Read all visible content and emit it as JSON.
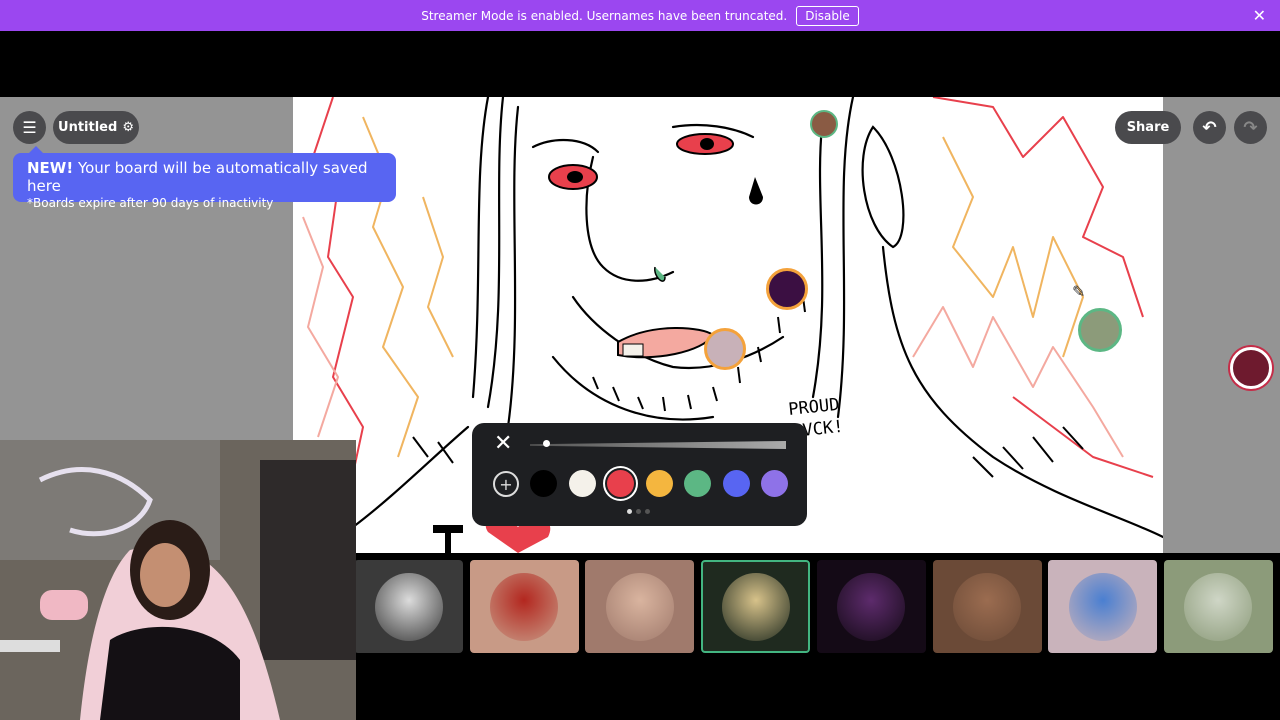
{
  "banner": {
    "message": "Streamer Mode is enabled. Usernames have been truncated.",
    "disable_label": "Disable",
    "close_icon": "close-icon"
  },
  "toolbar": {
    "board_title": "Untitled",
    "share_label": "Share"
  },
  "tip": {
    "headline": "NEW!",
    "message": " Your board will be automatically saved here",
    "subtext": "*Boards expire after 90 days of inactivity"
  },
  "drawing_text": {
    "line1": "PROUD",
    "line2": "CVCK!"
  },
  "palette": {
    "close_icon": "close-icon",
    "add_icon": "plus-icon",
    "brush_size": 0.05,
    "colors": [
      "#000000",
      "#f4f1ea",
      "#e8404c",
      "#f4b63f",
      "#5cb784",
      "#5865f2",
      "#8e72e8"
    ],
    "selected_color": "#e8404c",
    "page": 1,
    "page_count": 3
  },
  "participants": [
    {
      "name": "participant-1",
      "bg": "#3a3a3a",
      "accent": "#dcdcdc"
    },
    {
      "name": "participant-2",
      "bg": "#c89a86",
      "accent": "#b3271f"
    },
    {
      "name": "participant-3",
      "bg": "#a07a6c",
      "accent": "#d9b49f"
    },
    {
      "name": "participant-4",
      "bg": "#1f2a1f",
      "accent": "#d7c28a"
    },
    {
      "name": "participant-5",
      "bg": "#140a16",
      "accent": "#5d2b6c"
    },
    {
      "name": "participant-6",
      "bg": "#6b4a37",
      "accent": "#9b6c50"
    },
    {
      "name": "participant-7",
      "bg": "#c9b3bb",
      "accent": "#4a7fd1"
    },
    {
      "name": "participant-8",
      "bg": "#8c9b7a",
      "accent": "#cfd6c6"
    }
  ],
  "colors": {
    "banner": "#9b47f0",
    "blurple": "#5865f2",
    "active_tile_border": "#43b581"
  }
}
